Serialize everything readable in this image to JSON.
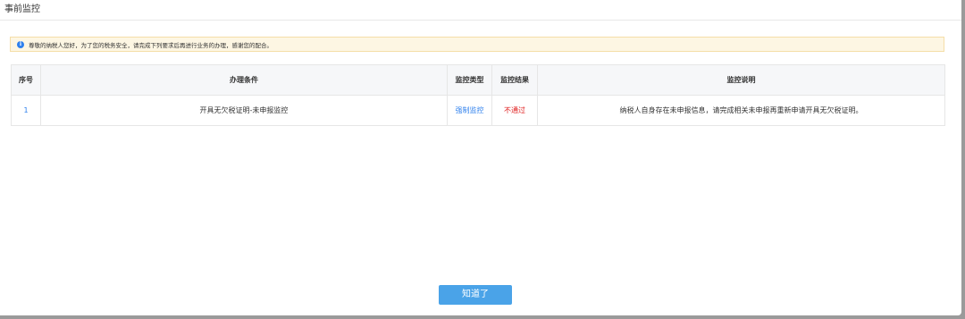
{
  "dialog": {
    "title": "事前监控",
    "notice": "尊敬的纳税人您好，为了您的税务安全，请完成下列要求后再进行业务的办理，感谢您的配合。",
    "info_icon": "i",
    "ok_label": "知道了"
  },
  "table": {
    "headers": {
      "index": "序号",
      "condition": "办理条件",
      "type": "监控类型",
      "result": "监控结果",
      "description": "监控说明"
    },
    "rows": [
      {
        "index": "1",
        "condition": "开具无欠税证明-未申报监控",
        "type": "强制监控",
        "result": "不通过",
        "description": "纳税人自身存在未申报信息，请完成相关未申报再重新申请开具无欠税证明。"
      }
    ]
  },
  "colors": {
    "accent": "#2f80ed",
    "fail": "#e02020",
    "button": "#4aa3e8",
    "notice_bg": "#fdf6e3"
  }
}
